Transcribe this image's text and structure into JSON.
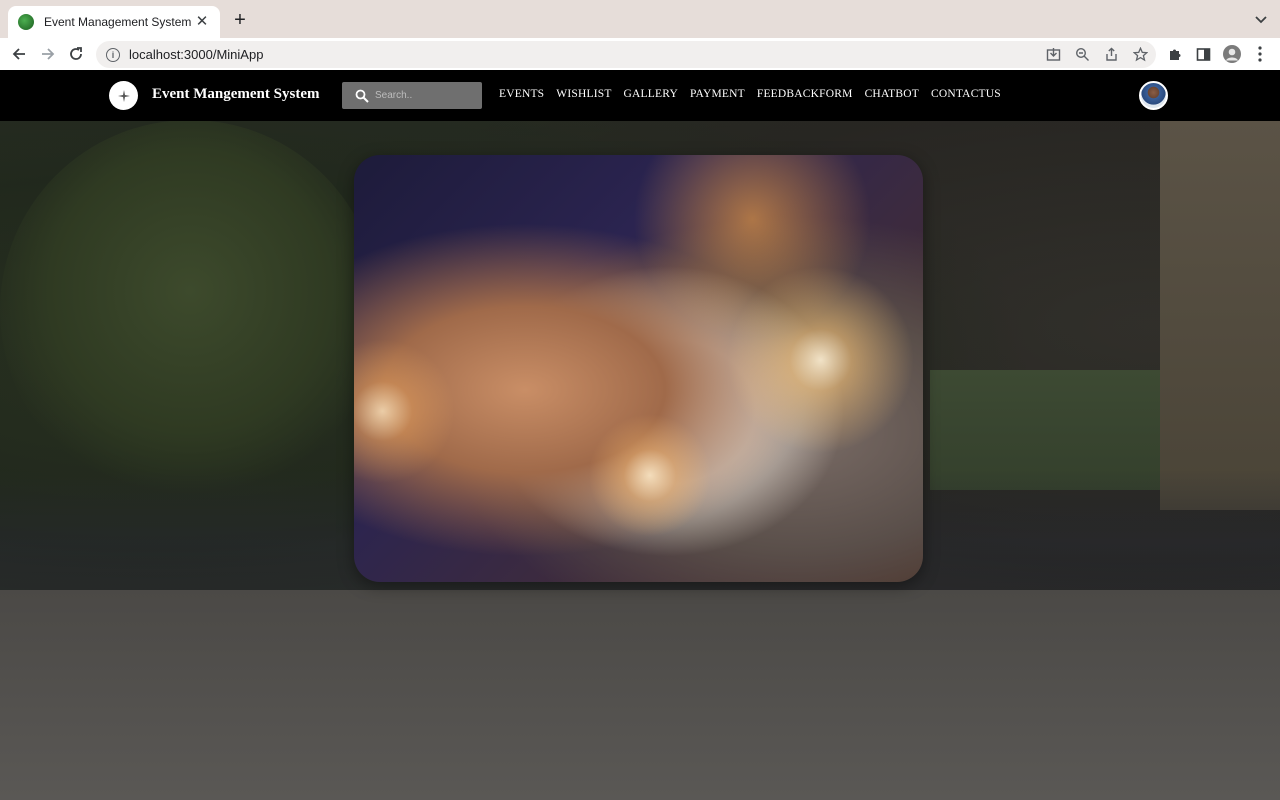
{
  "browser": {
    "tab_title": "Event Management System",
    "url": "localhost:3000/MiniApp"
  },
  "navbar": {
    "brand": "Event Mangement System",
    "search_placeholder": "Search..",
    "links": [
      "EVENTS",
      "WISHLIST",
      "GALLERY",
      "PAYMENT",
      "FEEDBACKFORM",
      "CHATBOT",
      "CONTACTUS"
    ]
  },
  "colors": {
    "navbar_bg": "#000000",
    "search_bg": "#6f6f6f",
    "tabstrip_bg": "#e6ddd9"
  },
  "icons": {
    "tab_favicon": "globe-favicon-icon",
    "tab_close": "close-icon",
    "new_tab": "plus-icon",
    "back": "back-arrow-icon",
    "forward": "forward-arrow-icon",
    "reload": "reload-icon",
    "site_info": "info-icon",
    "install": "download-icon",
    "zoom": "zoom-icon",
    "share": "share-icon",
    "bookmark": "star-icon",
    "extensions": "puzzle-icon",
    "side_panel": "side-panel-icon",
    "profile": "profile-avatar",
    "menu": "kebab-menu-icon",
    "search": "search-icon"
  }
}
